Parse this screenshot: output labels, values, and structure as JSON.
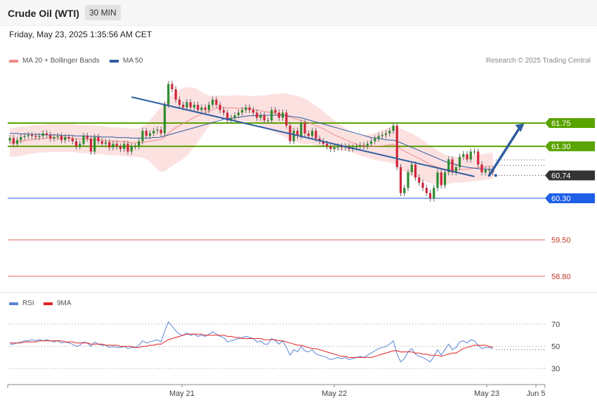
{
  "header": {
    "title": "Crude Oil (WTI)",
    "timeframe": "30 MIN"
  },
  "subheader": {
    "datetime": "Friday, May 23, 2025 1:35:56 AM CET"
  },
  "legend": {
    "ma20": {
      "label": "MA 20 + Bollinger Bands",
      "color": "#f08a8a"
    },
    "ma50": {
      "label": "MA 50",
      "color": "#2f5d9f"
    },
    "credit": "Research © 2025 Trading Central"
  },
  "rsi_legend": {
    "rsi": {
      "label": "RSI",
      "color": "#5b84d6"
    },
    "ma9": {
      "label": "9MA",
      "color": "#e02020"
    }
  },
  "chart_data": [
    {
      "type": "line",
      "title": "Crude Oil (WTI)",
      "x_ticks": [
        "May 21",
        "May 22",
        "May 23",
        "Jun 5"
      ],
      "ylim": [
        58.5,
        62.9
      ],
      "levels": [
        {
          "value": 61.75,
          "label": "61.75",
          "style": "resistance",
          "color": "#5aa400"
        },
        {
          "value": 61.3,
          "label": "61.30",
          "style": "resistance",
          "color": "#5aa400"
        },
        {
          "value": 60.74,
          "label": "60.74",
          "style": "last-price",
          "color": "#333333"
        },
        {
          "value": 60.3,
          "label": "60.30",
          "style": "support",
          "color": "#1e5fe6"
        },
        {
          "value": 59.5,
          "label": "59.50",
          "style": "target",
          "color": "#e06666"
        },
        {
          "value": 58.8,
          "label": "58.80",
          "style": "target",
          "color": "#e06666"
        }
      ],
      "close": [
        61.46,
        61.35,
        61.42,
        61.48,
        61.5,
        61.52,
        61.5,
        61.48,
        61.5,
        61.55,
        61.52,
        61.45,
        61.48,
        61.5,
        61.42,
        61.48,
        61.45,
        61.4,
        61.3,
        61.35,
        61.5,
        61.45,
        61.2,
        61.48,
        61.4,
        61.35,
        61.38,
        61.28,
        61.35,
        61.3,
        61.25,
        61.35,
        61.2,
        61.3,
        61.3,
        61.4,
        61.6,
        61.5,
        61.55,
        61.6,
        61.62,
        61.55,
        62.1,
        62.5,
        62.4,
        62.2,
        62.1,
        62.05,
        62.15,
        62.05,
        62.1,
        62.0,
        62.05,
        62.0,
        62.1,
        62.2,
        62.1,
        62.0,
        61.95,
        61.8,
        61.85,
        61.9,
        61.95,
        62.0,
        62.05,
        62.0,
        61.95,
        61.85,
        61.9,
        61.8,
        61.8,
        62.0,
        61.95,
        61.85,
        61.95,
        61.7,
        61.4,
        61.6,
        61.5,
        61.75,
        61.55,
        61.5,
        61.6,
        61.45,
        61.4,
        61.35,
        61.3,
        61.25,
        61.28,
        61.3,
        61.28,
        61.3,
        61.25,
        61.28,
        61.3,
        61.32,
        61.3,
        61.35,
        61.4,
        61.45,
        61.5,
        61.52,
        61.55,
        61.6,
        61.7,
        60.9,
        60.4,
        60.5,
        60.8,
        60.95,
        60.7,
        60.6,
        60.5,
        60.4,
        60.3,
        60.5,
        60.8,
        60.55,
        60.8,
        61.05,
        60.8,
        60.9,
        61.1,
        61.15,
        61.05,
        61.2,
        61.2,
        60.95,
        60.8,
        60.85,
        60.85,
        60.8
      ],
      "ma20": [
        61.38,
        61.38,
        61.39,
        61.4,
        61.41,
        61.42,
        61.43,
        61.44,
        61.45,
        61.45,
        61.46,
        61.46,
        61.46,
        61.46,
        61.46,
        61.47,
        61.46,
        61.46,
        61.45,
        61.44,
        61.44,
        61.44,
        61.43,
        61.43,
        61.42,
        61.42,
        61.41,
        61.4,
        61.4,
        61.4,
        61.39,
        61.39,
        61.38,
        61.37,
        61.37,
        61.37,
        61.38,
        61.39,
        61.4,
        61.41,
        61.42,
        61.43,
        61.48,
        61.55,
        61.61,
        61.66,
        61.7,
        61.74,
        61.78,
        61.82,
        61.86,
        61.89,
        61.92,
        61.95,
        61.98,
        62.01,
        62.03,
        62.05,
        62.05,
        62.04,
        62.04,
        62.04,
        62.03,
        62.03,
        62.03,
        62.02,
        62.01,
        62.0,
        61.99,
        61.97,
        61.96,
        61.95,
        61.94,
        61.92,
        61.91,
        61.89,
        61.86,
        61.84,
        61.82,
        61.8,
        61.78,
        61.76,
        61.73,
        61.7,
        61.67,
        61.64,
        61.6,
        61.56,
        61.52,
        61.49,
        61.46,
        61.43,
        61.4,
        61.37,
        61.34,
        61.32,
        61.31,
        61.31,
        61.3,
        61.3,
        61.31,
        61.31,
        61.32,
        61.33,
        61.34,
        61.3,
        61.25,
        61.21,
        61.17,
        61.14,
        61.1,
        61.07,
        61.03,
        60.99,
        60.95,
        60.92,
        60.9,
        60.88,
        60.86,
        60.85,
        60.85,
        60.85,
        60.85,
        60.86,
        60.86,
        60.87,
        60.88,
        60.89,
        60.9,
        60.91,
        60.92,
        60.93
      ],
      "ma50": [
        61.55,
        61.55,
        61.55,
        61.54,
        61.54,
        61.54,
        61.53,
        61.53,
        61.53,
        61.53,
        61.52,
        61.52,
        61.52,
        61.52,
        61.51,
        61.51,
        61.51,
        61.51,
        61.5,
        61.5,
        61.5,
        61.5,
        61.49,
        61.49,
        61.49,
        61.48,
        61.48,
        61.48,
        61.48,
        61.47,
        61.47,
        61.47,
        61.47,
        61.46,
        61.46,
        61.46,
        61.46,
        61.46,
        61.46,
        61.47,
        61.47,
        61.48,
        61.5,
        61.52,
        61.54,
        61.56,
        61.58,
        61.6,
        61.62,
        61.64,
        61.66,
        61.68,
        61.7,
        61.72,
        61.74,
        61.76,
        61.78,
        61.8,
        61.82,
        61.83,
        61.84,
        61.85,
        61.86,
        61.87,
        61.88,
        61.89,
        61.89,
        61.89,
        61.9,
        61.9,
        61.9,
        61.9,
        61.9,
        61.9,
        61.9,
        61.89,
        61.88,
        61.87,
        61.86,
        61.85,
        61.83,
        61.81,
        61.79,
        61.77,
        61.75,
        61.73,
        61.71,
        61.69,
        61.67,
        61.65,
        61.63,
        61.61,
        61.59,
        61.57,
        61.55,
        61.53,
        61.51,
        61.49,
        61.47,
        61.46,
        61.45,
        61.44,
        61.43,
        61.42,
        61.42,
        61.4,
        61.37,
        61.34,
        61.31,
        61.28,
        61.25,
        61.22,
        61.19,
        61.16,
        61.13,
        61.1,
        61.07,
        61.04,
        61.01,
        60.99,
        60.97,
        60.95,
        60.93,
        60.91,
        60.9,
        60.89,
        60.88,
        60.87,
        60.87,
        60.86,
        60.86,
        60.86
      ],
      "bb_halfwidth": [
        0.28,
        0.28,
        0.28,
        0.28,
        0.27,
        0.27,
        0.27,
        0.27,
        0.27,
        0.27,
        0.27,
        0.27,
        0.27,
        0.27,
        0.27,
        0.27,
        0.27,
        0.27,
        0.27,
        0.27,
        0.27,
        0.27,
        0.27,
        0.27,
        0.27,
        0.27,
        0.27,
        0.27,
        0.27,
        0.27,
        0.27,
        0.27,
        0.27,
        0.27,
        0.27,
        0.28,
        0.3,
        0.34,
        0.4,
        0.48,
        0.56,
        0.62,
        0.66,
        0.68,
        0.69,
        0.69,
        0.69,
        0.68,
        0.66,
        0.62,
        0.57,
        0.5,
        0.43,
        0.36,
        0.3,
        0.26,
        0.24,
        0.23,
        0.23,
        0.23,
        0.24,
        0.25,
        0.25,
        0.25,
        0.25,
        0.25,
        0.26,
        0.27,
        0.29,
        0.31,
        0.33,
        0.35,
        0.37,
        0.39,
        0.41,
        0.43,
        0.44,
        0.45,
        0.45,
        0.45,
        0.44,
        0.42,
        0.4,
        0.38,
        0.36,
        0.34,
        0.32,
        0.3,
        0.28,
        0.26,
        0.24,
        0.22,
        0.2,
        0.19,
        0.19,
        0.2,
        0.21,
        0.22,
        0.24,
        0.26,
        0.28,
        0.3,
        0.32,
        0.34,
        0.36,
        0.38,
        0.39,
        0.4,
        0.41,
        0.41,
        0.41,
        0.4,
        0.39,
        0.38,
        0.36,
        0.34,
        0.32,
        0.3,
        0.28,
        0.27,
        0.26,
        0.25,
        0.25,
        0.25,
        0.25,
        0.25,
        0.25,
        0.25,
        0.25,
        0.25,
        0.25,
        0.25
      ],
      "trendline": {
        "from": [
          33,
          62.25
        ],
        "to": [
          126,
          60.72
        ]
      },
      "projection_arrow": {
        "from": [
          130,
          60.74
        ],
        "to": [
          138,
          61.74
        ]
      }
    },
    {
      "type": "line",
      "title": "RSI",
      "ylim": [
        20,
        82
      ],
      "y_ticks": [
        "70",
        "50",
        "30"
      ],
      "y_tick_values": [
        70,
        50,
        30
      ],
      "series": [
        {
          "name": "RSI",
          "values": [
            52,
            52,
            53,
            54,
            55,
            55,
            56,
            55,
            56,
            55,
            56,
            55,
            54,
            55,
            53,
            54,
            53,
            52,
            50,
            51,
            54,
            53,
            50,
            54,
            52,
            51,
            51,
            49,
            50,
            49,
            49,
            50,
            48,
            49,
            49,
            51,
            55,
            53,
            54,
            55,
            56,
            54,
            64,
            72,
            68,
            64,
            61,
            60,
            62,
            60,
            61,
            59,
            60,
            59,
            61,
            63,
            61,
            59,
            58,
            54,
            55,
            56,
            57,
            58,
            59,
            58,
            57,
            54,
            55,
            52,
            52,
            57,
            55,
            52,
            55,
            49,
            42,
            47,
            45,
            50,
            46,
            45,
            47,
            43,
            42,
            41,
            40,
            38,
            39,
            40,
            39,
            40,
            38,
            39,
            40,
            41,
            40,
            42,
            44,
            46,
            48,
            49,
            50,
            52,
            55,
            43,
            36,
            39,
            45,
            48,
            43,
            41,
            40,
            38,
            36,
            41,
            47,
            42,
            47,
            52,
            47,
            49,
            54,
            55,
            53,
            56,
            55,
            51,
            48,
            49,
            49,
            48
          ]
        },
        {
          "name": "9MA",
          "values": [
            53,
            53,
            53,
            53,
            54,
            54,
            54,
            54,
            55,
            55,
            55,
            55,
            55,
            55,
            55,
            54,
            54,
            54,
            53,
            53,
            53,
            53,
            52,
            52,
            52,
            52,
            51,
            51,
            51,
            51,
            50,
            50,
            50,
            50,
            49,
            49,
            50,
            50,
            51,
            51,
            52,
            52,
            54,
            56,
            57,
            58,
            59,
            60,
            61,
            61,
            61,
            61,
            61,
            60,
            60,
            60,
            60,
            60,
            60,
            59,
            59,
            58,
            58,
            57,
            57,
            57,
            57,
            57,
            57,
            56,
            56,
            56,
            56,
            55,
            55,
            54,
            53,
            52,
            51,
            51,
            50,
            49,
            48,
            48,
            47,
            46,
            45,
            44,
            43,
            42,
            41,
            41,
            40,
            40,
            40,
            40,
            40,
            40,
            40,
            41,
            42,
            43,
            44,
            45,
            46,
            46,
            45,
            45,
            45,
            45,
            44,
            44,
            43,
            43,
            42,
            42,
            42,
            41,
            42,
            43,
            44,
            44,
            46,
            48,
            49,
            50,
            51,
            51,
            51,
            51,
            50,
            49
          ]
        }
      ]
    }
  ]
}
